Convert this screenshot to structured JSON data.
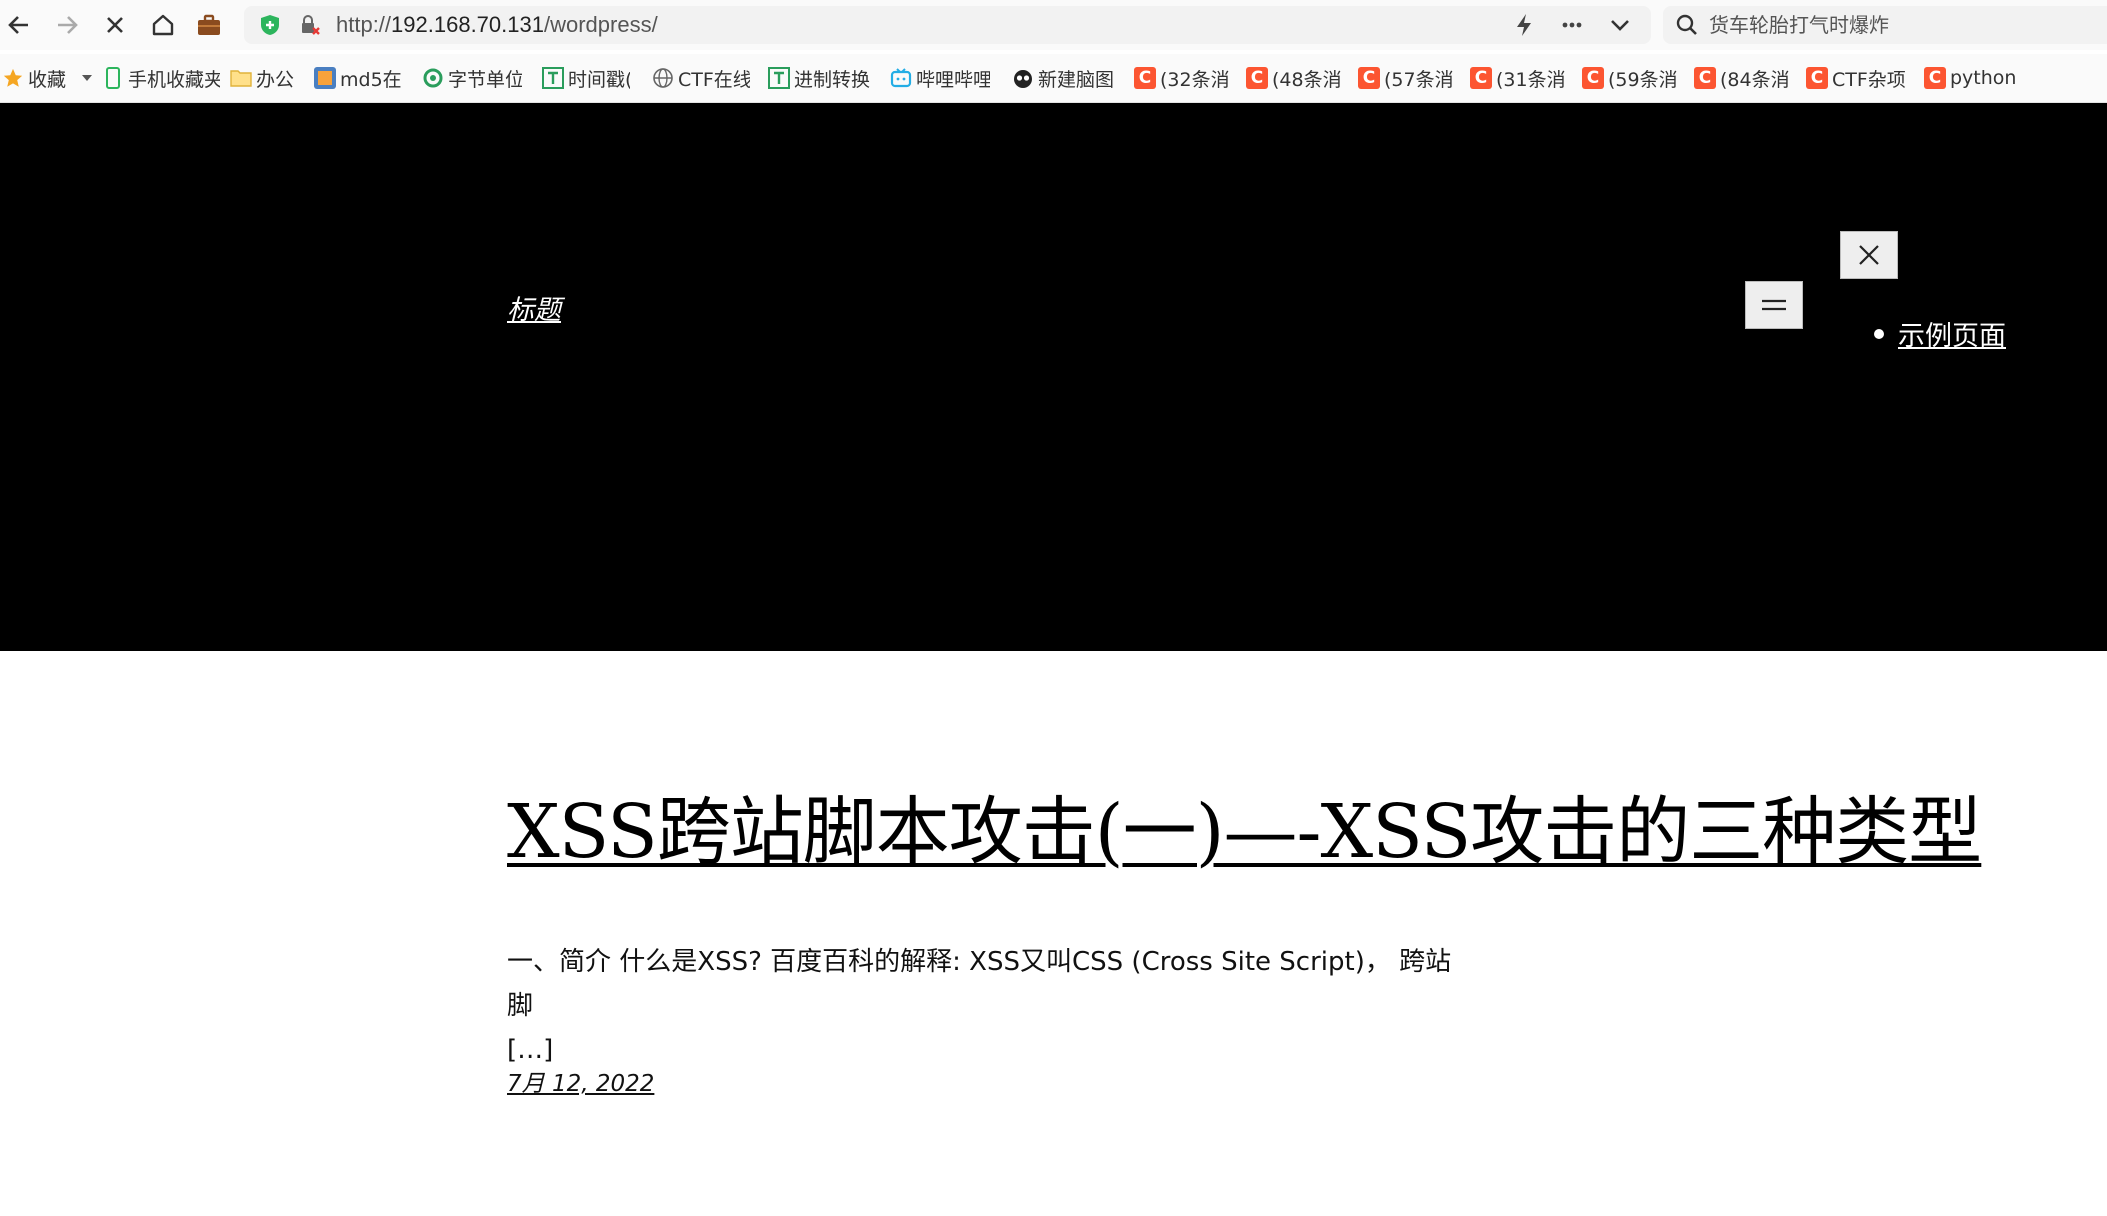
{
  "browser": {
    "url_prefix": "http://",
    "url_host": "192.168.70.131",
    "url_path": "/wordpress/",
    "search_placeholder": "货车轮胎打气时爆炸"
  },
  "bookmarks": [
    {
      "label": "收藏",
      "icon": "star-icon"
    },
    {
      "label": "手机收藏夹",
      "icon": "phone-icon"
    },
    {
      "label": "办公",
      "icon": "folder-icon"
    },
    {
      "label": "md5在",
      "icon": "site-icon"
    },
    {
      "label": "字节单位",
      "icon": "site-icon"
    },
    {
      "label": "时间戳(",
      "icon": "site-icon"
    },
    {
      "label": "CTF在线",
      "icon": "globe-icon"
    },
    {
      "label": "进制转换",
      "icon": "site-icon"
    },
    {
      "label": "哔哩哔哩",
      "icon": "bilibili-icon"
    },
    {
      "label": "新建脑图",
      "icon": "site-icon"
    },
    {
      "label": "(32条消",
      "icon": "csdn-icon"
    },
    {
      "label": "(48条消",
      "icon": "csdn-icon"
    },
    {
      "label": "(57条消",
      "icon": "csdn-icon"
    },
    {
      "label": "(31条消",
      "icon": "csdn-icon"
    },
    {
      "label": "(59条消",
      "icon": "csdn-icon"
    },
    {
      "label": "(84条消",
      "icon": "csdn-icon"
    },
    {
      "label": "CTF杂项",
      "icon": "csdn-icon"
    },
    {
      "label": "python",
      "icon": "csdn-icon"
    }
  ],
  "site": {
    "title": "标题",
    "nav_items": [
      "示例页面"
    ]
  },
  "post": {
    "title": "XSS跨站脚本攻击(一)—-XSS攻击的三种类型",
    "excerpt_line1": "一、简介 什么是XSS? 百度百科的解释: XSS又叫CSS (Cross Site Script)， 跨站脚",
    "excerpt_line2": "[…]",
    "date": "7月 12, 2022"
  },
  "colors": {
    "hero_bg": "#000000",
    "csdn_brand": "#fc5531",
    "star": "#f5a623"
  }
}
